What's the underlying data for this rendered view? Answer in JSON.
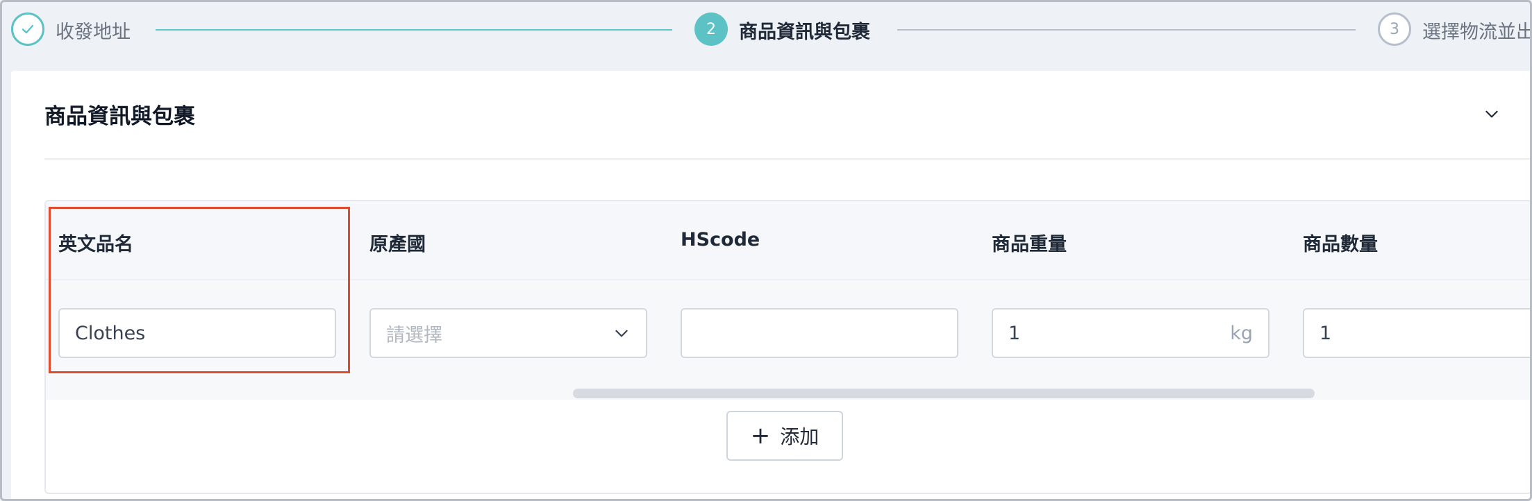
{
  "stepper": {
    "steps": [
      {
        "index": "",
        "label": "收發地址",
        "state": "done"
      },
      {
        "index": "2",
        "label": "商品資訊與包裹",
        "state": "active"
      },
      {
        "index": "3",
        "label": "選擇物流並出",
        "state": "todo"
      }
    ]
  },
  "section": {
    "title": "商品資訊與包裹"
  },
  "table": {
    "columns": [
      "英文品名",
      "原產國",
      "HScode",
      "商品重量",
      "商品數量"
    ],
    "row": {
      "name_value": "Clothes",
      "origin_placeholder": "請選擇",
      "hscode_value": "",
      "weight_value": "1",
      "weight_unit": "kg",
      "quantity_value": "1"
    }
  },
  "actions": {
    "add_label": "添加"
  },
  "colors": {
    "accent": "#5cc2c5",
    "highlight": "#e04a2f"
  }
}
